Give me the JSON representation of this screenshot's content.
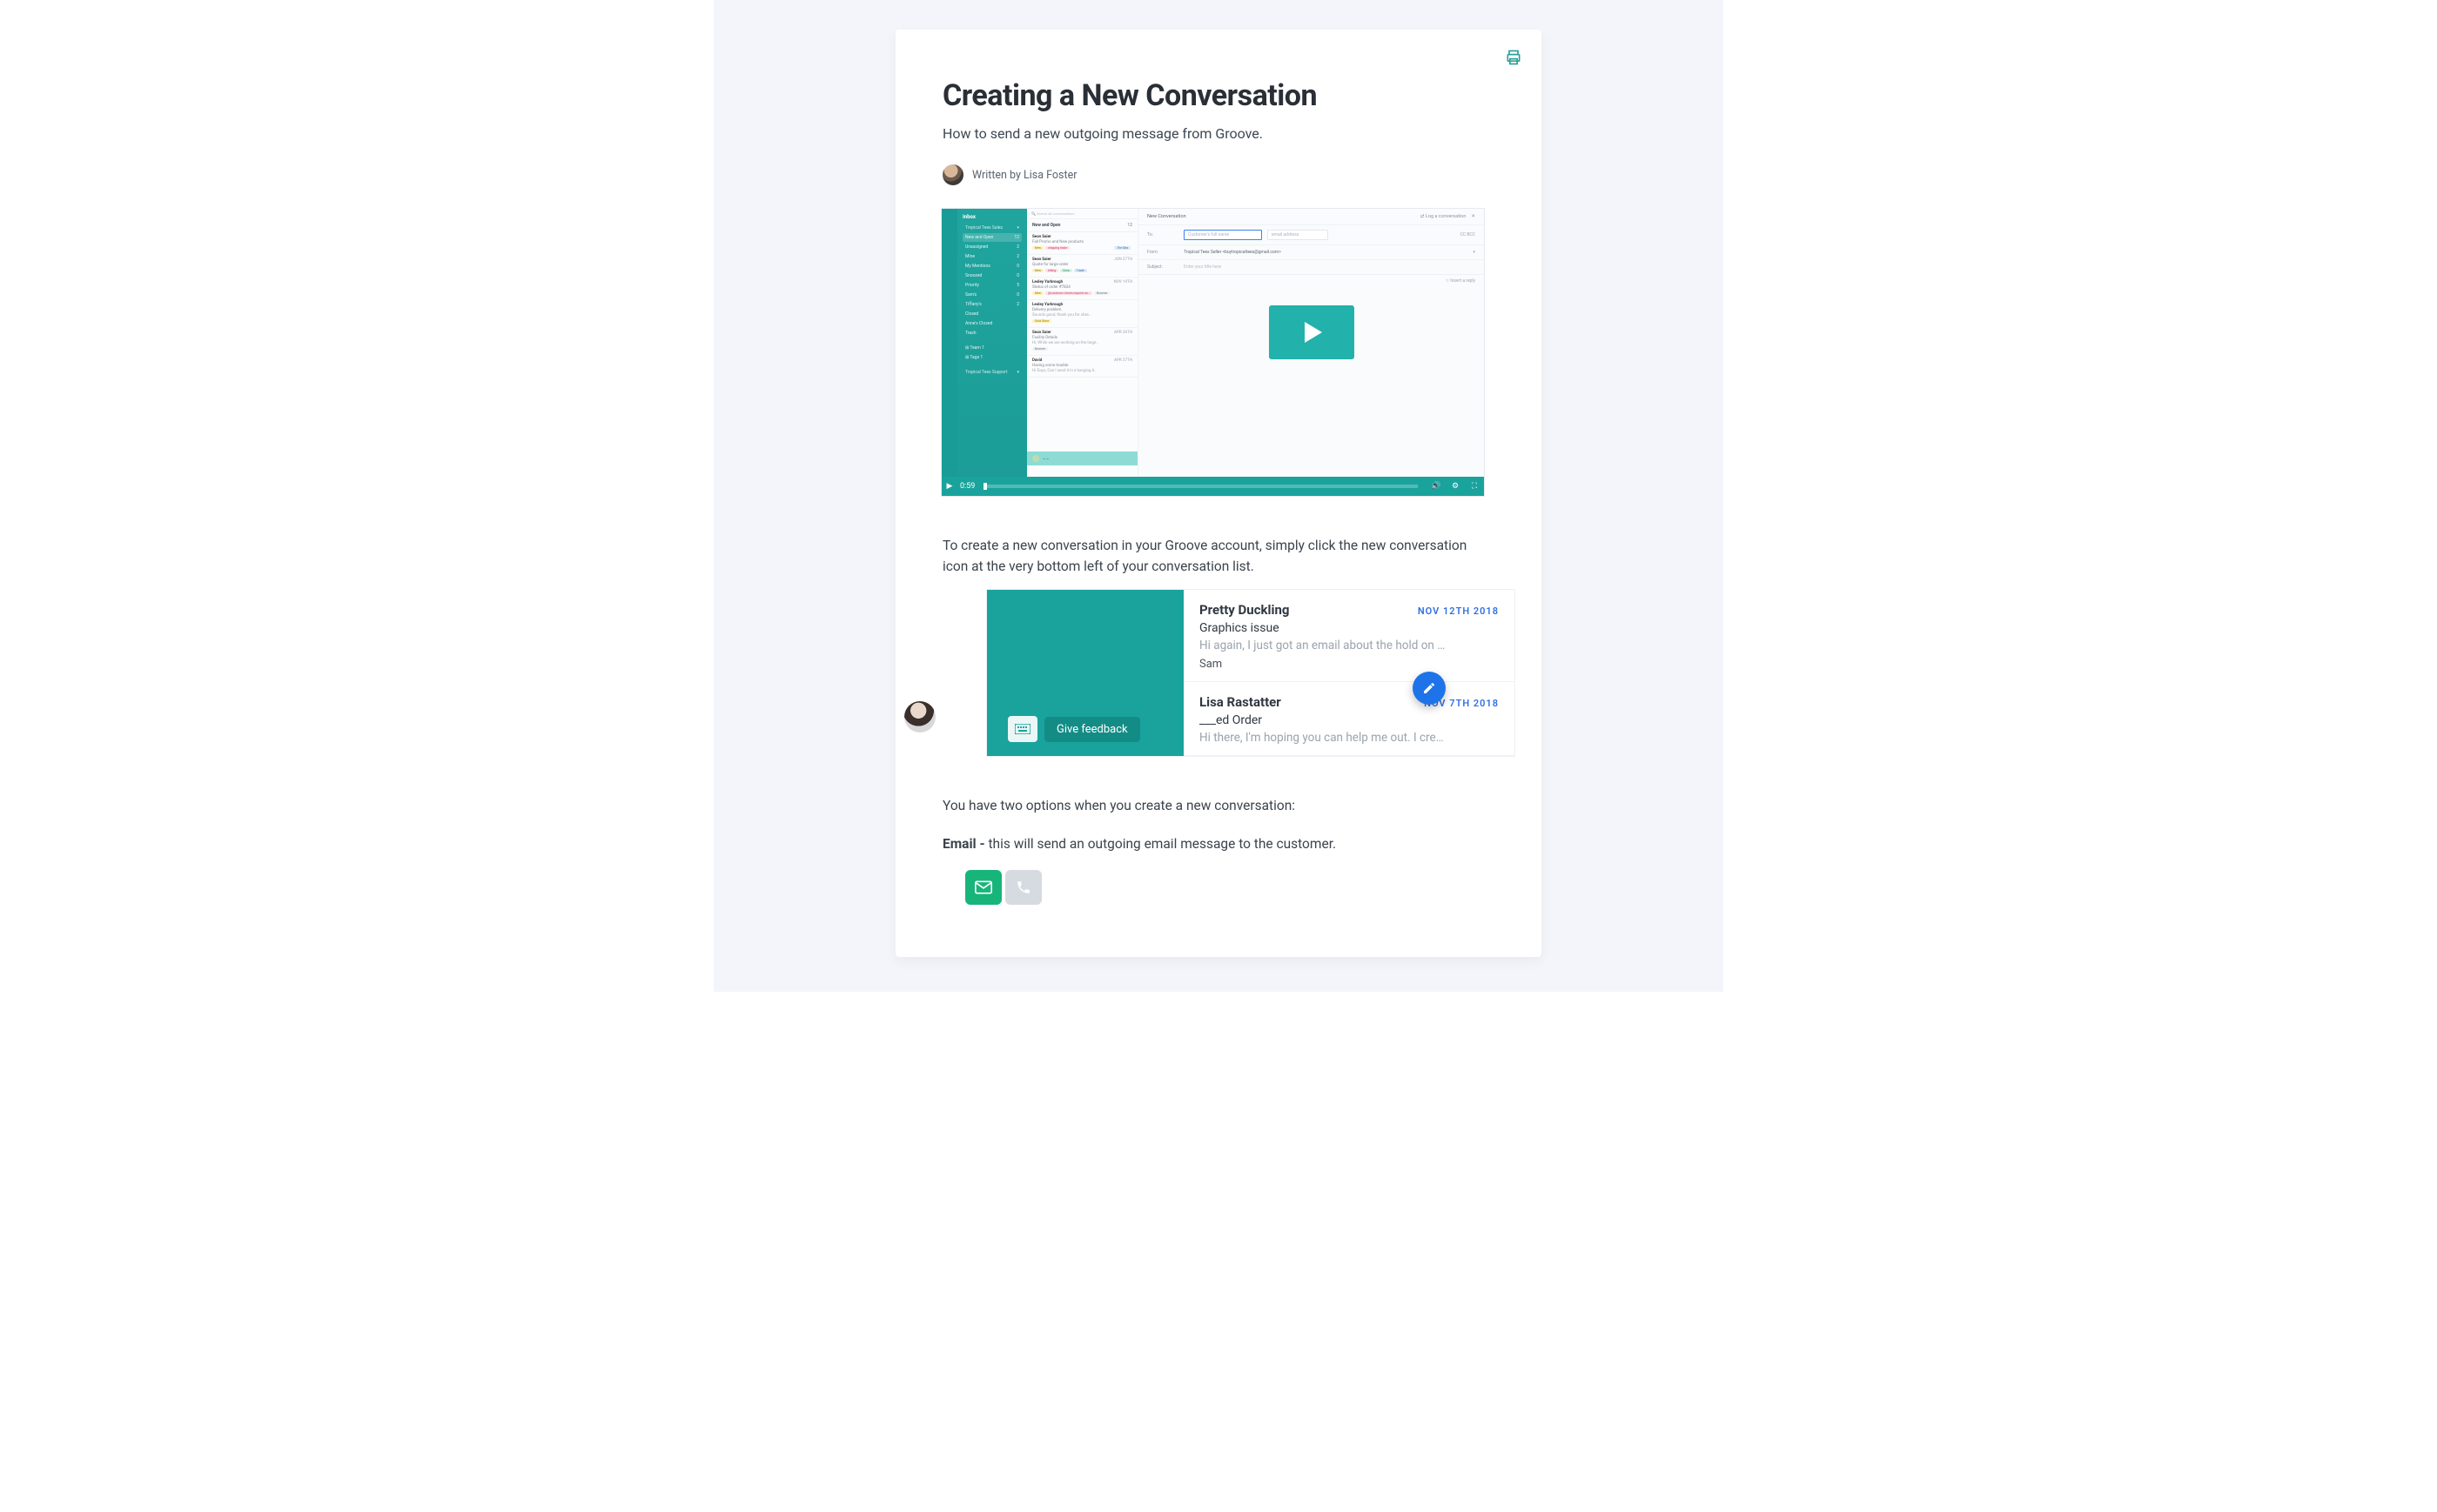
{
  "article": {
    "title": "Creating a New Conversation",
    "subtitle": "How to send a new outgoing message from Groove.",
    "author_line": "Written by Lisa Foster",
    "intro_p": "To create a new conversation in your Groove account, simply click the new conversation icon at the very bottom left of your conversation list.",
    "options_p": "You have two options when you create a new conversation:",
    "email_p_prefix": "Email - ",
    "email_p_rest": "this will send an outgoing email message to the customer."
  },
  "video": {
    "sidebar_title": "Inbox",
    "sidebar_group": "Tropical Tees Sales",
    "sidebar_items": [
      {
        "label": "New and Open",
        "count": "12",
        "selected": true
      },
      {
        "label": "Unassigned",
        "count": "2"
      },
      {
        "label": "Mine",
        "count": "2"
      },
      {
        "label": "My Mentions",
        "count": "0"
      },
      {
        "label": "Snoozed",
        "count": "0"
      },
      {
        "label": "Priority",
        "count": "5"
      },
      {
        "label": "Sam's",
        "count": "0"
      },
      {
        "label": "Tiffany's",
        "count": "2"
      },
      {
        "label": "Closed",
        "count": ""
      },
      {
        "label": "Anne's Closed",
        "count": ""
      },
      {
        "label": "Trash",
        "count": ""
      }
    ],
    "sidebar_tags": [
      "Team 1",
      "Tags 1"
    ],
    "sidebar_group2": "Tropical Tees Support",
    "list_search_ph": "Search all conversations",
    "list_header": "New and Open",
    "list_cards": [
      {
        "name": "Sean Saier",
        "sub": "Fall Promo and New products",
        "tags": [
          "New",
          "shipping trade"
        ],
        "right": "The Sha"
      },
      {
        "name": "Sean Saier",
        "sub": "Quote for large order",
        "date": "JUN 27TH",
        "tags": [
          "New",
          "billing",
          "Groo",
          "Trade"
        ]
      },
      {
        "name": "Lesley Yarbrough",
        "sub": "Status of order #7834",
        "date": "NOV 14TH",
        "tags": [
          "New",
          "@customer stores request an…"
        ],
        "extra": "Boomer"
      },
      {
        "name": "Lesley Yarbrough",
        "sub": "Delivery problem",
        "date": "",
        "line": "Sounds good, thank you for chec…",
        "tags": [
          "Gold Store"
        ]
      },
      {
        "name": "Sean Saier",
        "sub": "Facility Details",
        "date": "APR 26TH",
        "line": "Hi, While we are working on the large…",
        "extra": "Boomer"
      },
      {
        "name": "David",
        "sub": "Having some trouble",
        "date": "APR 27TH",
        "line": "Hi Guys, Can I send it in a hanging b…"
      }
    ],
    "main_title": "New Conversation",
    "main_log": "Log a conversation",
    "to_label": "To:",
    "to_ph": "Customer's full name",
    "to_email_ph": "email address",
    "from_label": "From:",
    "from_value": "Tropical Tees Seller <buytropicaltees@gmail.com>",
    "subj_label": "Subject:",
    "subj_ph": "Enter your title here",
    "reply_hint": "Insert a reply",
    "cc_bcc": "CC   BCC",
    "timebar": "0:59"
  },
  "convo": {
    "feedback_label": "Give feedback",
    "items": [
      {
        "who": "Pretty Duckling",
        "date": "NOV 12TH 2018",
        "subject": "Graphics issue",
        "preview": "Hi again, I just got an email about the hold on …",
        "assignee": "Sam"
      },
      {
        "who": "Lisa Rastatter",
        "date": "NOV 7TH 2018",
        "subject": "___ed Order",
        "preview": "Hi there, I'm hoping you can help me out. I cre…"
      }
    ]
  }
}
